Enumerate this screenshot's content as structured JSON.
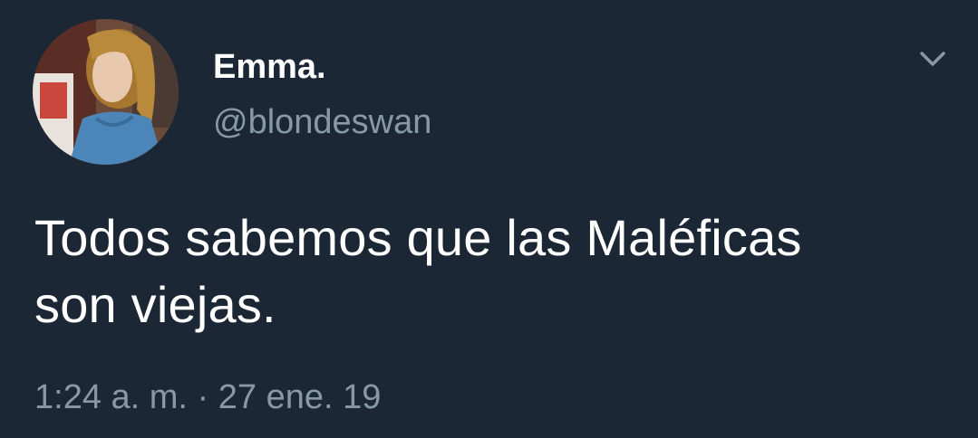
{
  "tweet": {
    "author": {
      "display_name": "Emma.",
      "handle": "@blondeswan",
      "avatar_icon": "profile-photo"
    },
    "menu_icon": "chevron-down-icon",
    "text_line1": "Todos sabemos que las Maléficas",
    "text_line2": "son viejas.",
    "timestamp": "1:24 a. m. · 27 ene. 19"
  },
  "colors": {
    "background": "#1c2735",
    "primary_text": "#ffffff",
    "secondary_text": "#8899a6"
  }
}
